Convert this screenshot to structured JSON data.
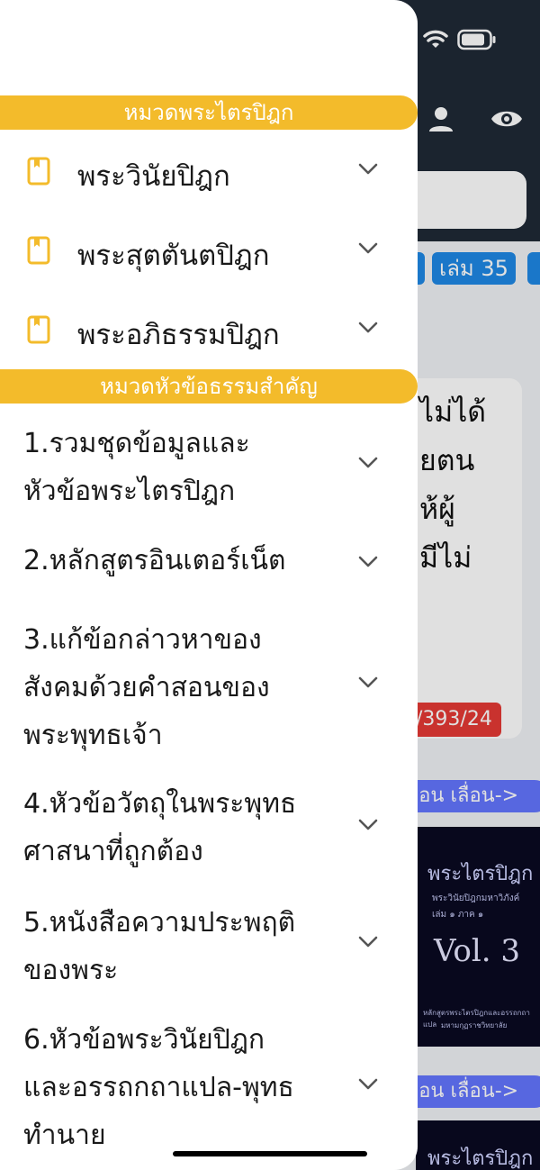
{
  "drawer": {
    "section1": {
      "title": "หมวดพระไตรปิฎก"
    },
    "items": [
      {
        "label": "พระวินัยปิฎก"
      },
      {
        "label": "พระสุตตันตปิฎก"
      },
      {
        "label": "พระอภิธรรมปิฎก"
      }
    ],
    "section2": {
      "title": "หมวดหัวข้อธรรมสำคัญ"
    },
    "topics": [
      {
        "label": "1.รวมชุดข้อมูลและ\nหัวข้อพระไตรปิฎก"
      },
      {
        "label": "2.หลักสูตรอินเตอร์เน็ต"
      },
      {
        "label": "3.แก้ข้อกล่าวหาของ\nสังคมด้วยคำสอนของ\nพระพุทธเจ้า"
      },
      {
        "label": "4.หัวข้อวัตถุในพระพุทธ\nศาสนาที่ถูกต้อง"
      },
      {
        "label": "5.หนังสือความประพฤติ\nของพระ"
      },
      {
        "label": "6.หัวข้อพระวินัยปิฎก\nและอรรถกถาแปล-พุทธ\nทำนาย"
      }
    ]
  },
  "background": {
    "volume_chip": "เล่ม 35",
    "card_text": "ไม่ได้\nยตน\nห้ผู้\nมีไม่",
    "reference": "/393/24",
    "nav_label_1": "อ่อน  เลื่อน->",
    "nav_label_2": "อ่อน  เลื่อน->",
    "book_title": "พระไตรปิฎก",
    "book_subtitle": "พระวินัยปิฎกมหาวิภังค์",
    "book_sub2": "เล่ม ๑ ภาค ๑",
    "book_volume": "Vol.  3",
    "book_footer": "หลักสูตรพระไตรปิฎกและอรรถกถาแปล",
    "book_footer2": "มหามกุฏราชวิทยาลัย",
    "book_title_2": "พระไตรปิฎก"
  },
  "colors": {
    "accent_yellow": "#f3bb2b",
    "header_dark": "#1f2a36",
    "chip_blue": "#1e88e5",
    "badge_red": "#e53935",
    "pill_blue": "#6476ff"
  },
  "icons": [
    "wifi-icon",
    "battery-icon",
    "person-icon",
    "eye-icon",
    "book-icon",
    "chevron-down-icon"
  ]
}
